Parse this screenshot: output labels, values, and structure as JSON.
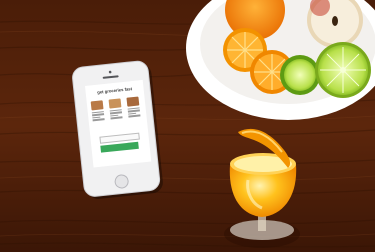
{
  "phone_screen": {
    "title": "get groceries fast",
    "cta_color": "#39a85a"
  }
}
